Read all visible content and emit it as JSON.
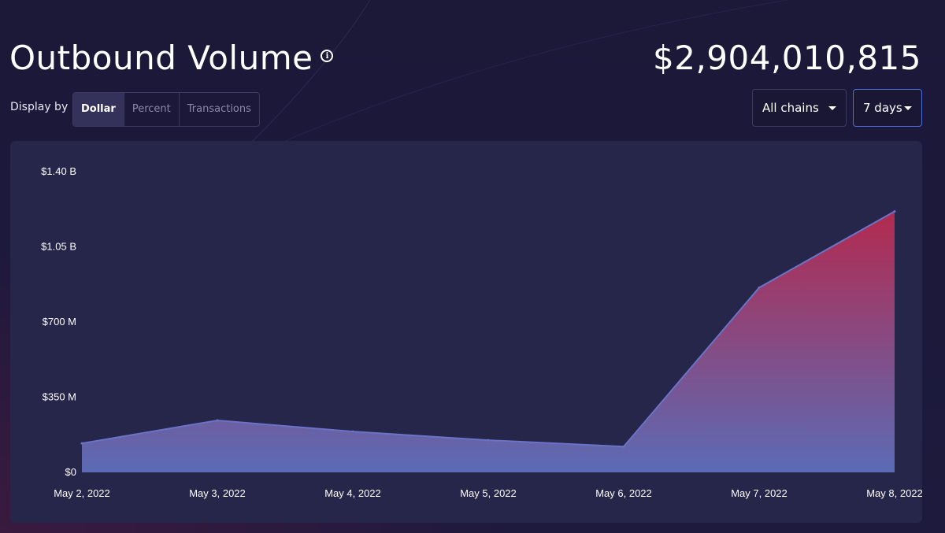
{
  "header": {
    "title": "Outbound Volume",
    "info_icon": "info-icon",
    "total": "$2,904,010,815"
  },
  "controls": {
    "display_by_label": "Display by",
    "segments": [
      "Dollar",
      "Percent",
      "Transactions"
    ],
    "active_segment": "Dollar",
    "chains_dropdown": "All chains",
    "range_dropdown": "7 days"
  },
  "colors": {
    "area_top": "#b32a4f",
    "area_bottom": "#5b6bb5",
    "line": "#6a73c8",
    "card_bg": "#26254a",
    "active_dropdown_border": "#4f6fd8"
  },
  "chart_data": {
    "type": "area",
    "categories": [
      "May 2, 2022",
      "May 3, 2022",
      "May 4, 2022",
      "May 5, 2022",
      "May 6, 2022",
      "May 7, 2022",
      "May 8, 2022"
    ],
    "series": [
      {
        "values": [
          135000000,
          242000000,
          190000000,
          150000000,
          120000000,
          860000000,
          1215000000
        ]
      }
    ],
    "y_ticks": [
      "$0",
      "$350 M",
      "$700 M",
      "$1.05 B",
      "$1.40 B"
    ],
    "y_tick_values": [
      0,
      350000000,
      700000000,
      1050000000,
      1400000000
    ],
    "ylim": [
      0,
      1400000000
    ],
    "grid": false,
    "legend": false
  }
}
